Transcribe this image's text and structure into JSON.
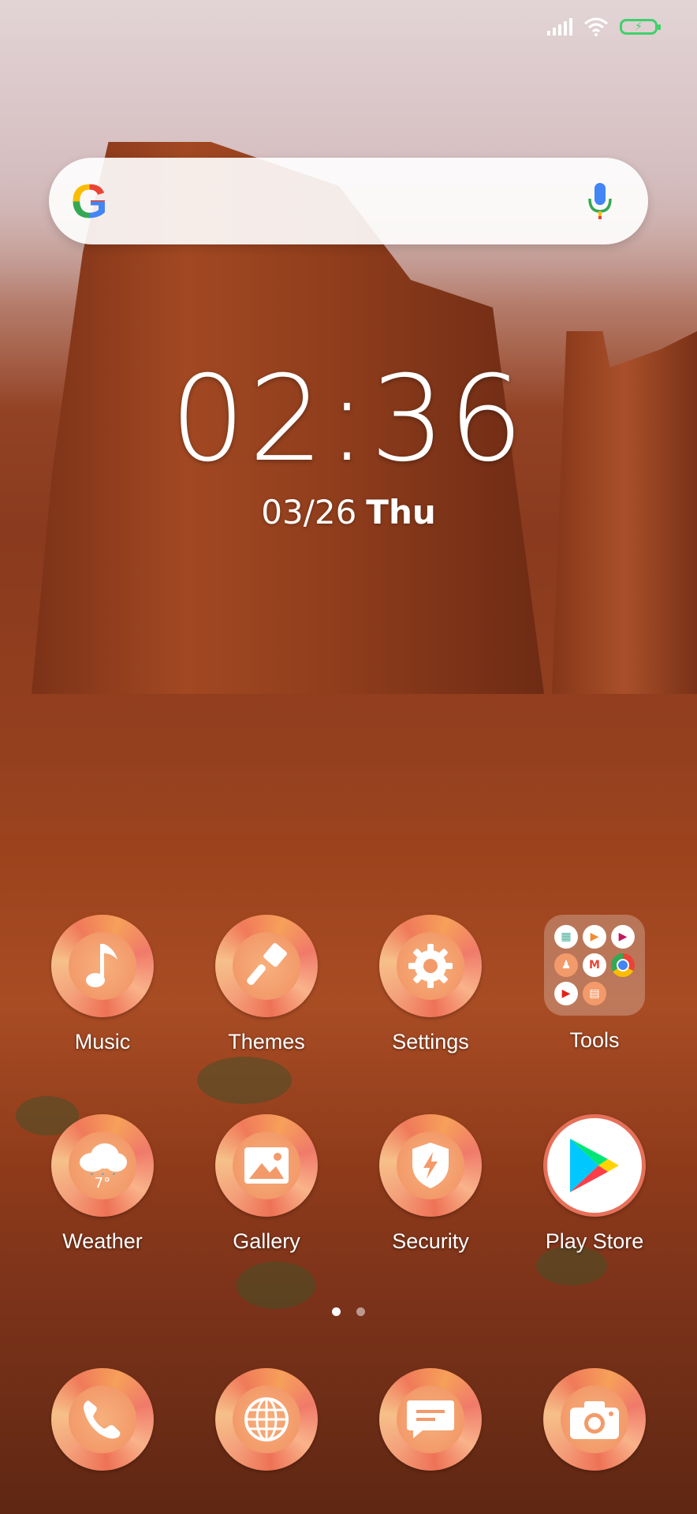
{
  "clock": {
    "time": "02:36",
    "date": "03/26",
    "day": "Thu"
  },
  "status_bar": {
    "signal": "signal-icon",
    "wifi": "wifi-icon",
    "battery": "battery-charging-icon"
  },
  "search": {
    "logo": "G",
    "mic_icon": "mic-icon"
  },
  "apps_row1": [
    {
      "label": "Music",
      "icon": "music-note-icon"
    },
    {
      "label": "Themes",
      "icon": "paintbrush-icon"
    },
    {
      "label": "Settings",
      "icon": "gear-icon"
    },
    {
      "label": "Tools",
      "icon": "folder-icon"
    }
  ],
  "apps_row2": [
    {
      "label": "Weather",
      "icon": "cloud-rain-icon",
      "temp": "7°"
    },
    {
      "label": "Gallery",
      "icon": "image-icon"
    },
    {
      "label": "Security",
      "icon": "shield-bolt-icon"
    },
    {
      "label": "Play Store",
      "icon": "play-store-icon"
    }
  ],
  "dock": [
    {
      "icon": "phone-icon"
    },
    {
      "icon": "globe-icon"
    },
    {
      "icon": "message-icon"
    },
    {
      "icon": "camera-icon"
    }
  ],
  "page_indicator": {
    "pages": 2,
    "active": 1
  },
  "colors": {
    "battery": "#3fd16b",
    "icon_base": "#f39a6a"
  }
}
